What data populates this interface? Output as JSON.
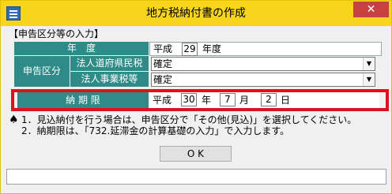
{
  "window": {
    "title": "地方税納付書の作成",
    "close_glyph": "✕",
    "icon": "app-icon"
  },
  "form": {
    "section_title": "【申告区分等の入力】",
    "year_row": {
      "label": "年　度",
      "era": "平成",
      "year_value": "29",
      "suffix": "年度"
    },
    "declaration": {
      "label": "申告区分",
      "rows": [
        {
          "label": "法人道府県民税",
          "value": "確定"
        },
        {
          "label": "法人事業税等",
          "value": "確定"
        }
      ],
      "dropdown_glyph": "▼"
    },
    "due_date": {
      "label": "納 期 限",
      "era": "平成",
      "year_value": "30",
      "year_suffix": "年",
      "month_value": "7",
      "month_suffix": "月",
      "day_value": "2",
      "day_suffix": "日"
    }
  },
  "notes": {
    "mark": "♠",
    "lines": [
      "1．見込納付を行う場合は、申告区分で「その他(見込)」を選択してください。",
      "2．納期限は、「732.延滞金の計算基礎の入力」で入力します。"
    ]
  },
  "buttons": {
    "ok_label": "O K"
  },
  "colors": {
    "titlebar": "#f7d51c",
    "label_bg": "#2e8b87",
    "highlight": "#e0101e",
    "close": "#c7423f"
  }
}
